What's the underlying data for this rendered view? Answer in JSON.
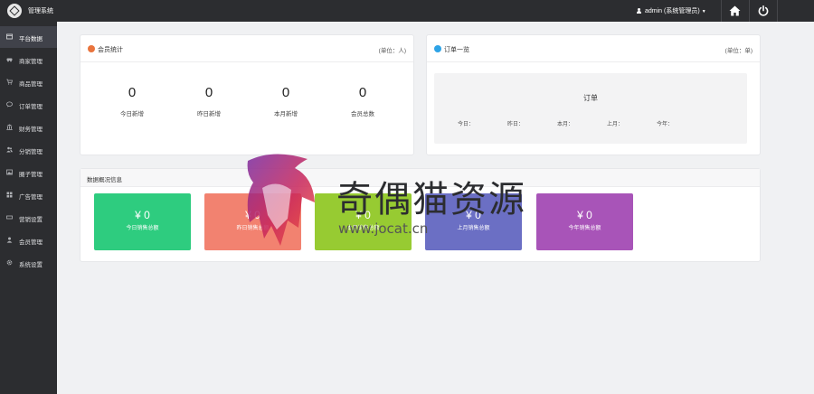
{
  "app": {
    "title": "管理系统"
  },
  "topbar": {
    "user": "admin (系统管理员)"
  },
  "sidebar": {
    "items": [
      {
        "label": "平台数据",
        "icon": "dashboard-icon",
        "active": true
      },
      {
        "label": "商家管理",
        "icon": "car-icon"
      },
      {
        "label": "商品管理",
        "icon": "cart-icon"
      },
      {
        "label": "订单管理",
        "icon": "chat-icon"
      },
      {
        "label": "财务管理",
        "icon": "bank-icon"
      },
      {
        "label": "分销管理",
        "icon": "users-icon"
      },
      {
        "label": "圈子管理",
        "icon": "image-icon"
      },
      {
        "label": "广告管理",
        "icon": "grid-icon"
      },
      {
        "label": "营销设置",
        "icon": "marketing-icon"
      },
      {
        "label": "会员管理",
        "icon": "user-icon"
      },
      {
        "label": "系统设置",
        "icon": "gear-icon"
      }
    ]
  },
  "member_panel": {
    "title": "会员统计",
    "unit": "(单位：人)",
    "stats": [
      {
        "value": "0",
        "label": "今日新增"
      },
      {
        "value": "0",
        "label": "昨日新增"
      },
      {
        "value": "0",
        "label": "本月新增"
      },
      {
        "value": "0",
        "label": "会员总数"
      }
    ]
  },
  "order_panel": {
    "title": "订单一览",
    "unit": "(单位：单)",
    "box_title": "订单",
    "fields": [
      "今日：",
      "昨日：",
      "本月：",
      "上月：",
      "今年："
    ]
  },
  "overview_panel": {
    "title": "数据概况信息",
    "tiles": [
      {
        "amount": "¥ 0",
        "label": "今日销售总额",
        "color": "#2ecc7f"
      },
      {
        "amount": "¥ 0",
        "label": "昨日销售总额",
        "color": "#f28270"
      },
      {
        "amount": "¥ 0",
        "label": "本月销售总额",
        "color": "#97cb32"
      },
      {
        "amount": "¥ 0",
        "label": "上月销售总额",
        "color": "#6b6fc4"
      },
      {
        "amount": "¥ 0",
        "label": "今年销售总额",
        "color": "#a854b8"
      }
    ]
  },
  "watermark": {
    "text": "奇偶猫资源",
    "url": "www.jocat.cn"
  },
  "colors": {
    "sidebar_bg": "#2c2d30",
    "accent_orange": "#e9743d",
    "accent_blue": "#2ea3e6"
  }
}
